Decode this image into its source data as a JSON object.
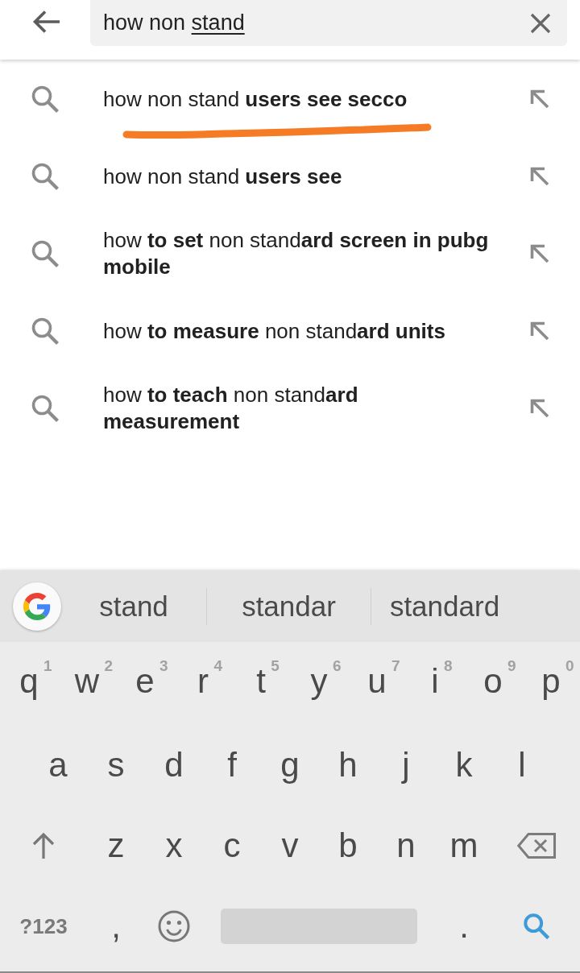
{
  "top_bar": {
    "search": {
      "typed": "how non",
      "composing": "stand"
    }
  },
  "suggestions": [
    {
      "text": "how non stand **users see secco**",
      "annotated": true
    },
    {
      "text": "how non stand **users see**",
      "annotated": false
    },
    {
      "text": "how **to set** non stand**ard screen in pubg mobile**",
      "annotated": false
    },
    {
      "text": "how **to measure** non stand**ard units**",
      "annotated": false
    },
    {
      "text": "how **to teach** non stand**ard measurement**",
      "annotated": false
    }
  ],
  "keyboard": {
    "candidates": [
      "stand",
      "standar",
      "standard"
    ],
    "letter_rows": [
      [
        {
          "kind": "letter",
          "label": "q",
          "hint": "1"
        },
        {
          "kind": "letter",
          "label": "w",
          "hint": "2"
        },
        {
          "kind": "letter",
          "label": "e",
          "hint": "3"
        },
        {
          "kind": "letter",
          "label": "r",
          "hint": "4"
        },
        {
          "kind": "letter",
          "label": "t",
          "hint": "5"
        },
        {
          "kind": "letter",
          "label": "y",
          "hint": "6"
        },
        {
          "kind": "letter",
          "label": "u",
          "hint": "7"
        },
        {
          "kind": "letter",
          "label": "i",
          "hint": "8"
        },
        {
          "kind": "letter",
          "label": "o",
          "hint": "9"
        },
        {
          "kind": "letter",
          "label": "p",
          "hint": "0"
        }
      ],
      [
        {
          "kind": "letter",
          "label": "a"
        },
        {
          "kind": "letter",
          "label": "s"
        },
        {
          "kind": "letter",
          "label": "d"
        },
        {
          "kind": "letter",
          "label": "f"
        },
        {
          "kind": "letter",
          "label": "g"
        },
        {
          "kind": "letter",
          "label": "h"
        },
        {
          "kind": "letter",
          "label": "j"
        },
        {
          "kind": "letter",
          "label": "k"
        },
        {
          "kind": "letter",
          "label": "l"
        }
      ],
      [
        {
          "kind": "shift"
        },
        {
          "kind": "letter",
          "label": "z"
        },
        {
          "kind": "letter",
          "label": "x"
        },
        {
          "kind": "letter",
          "label": "c"
        },
        {
          "kind": "letter",
          "label": "v"
        },
        {
          "kind": "letter",
          "label": "b"
        },
        {
          "kind": "letter",
          "label": "n"
        },
        {
          "kind": "letter",
          "label": "m"
        },
        {
          "kind": "backspace"
        }
      ]
    ],
    "bottom_row": [
      {
        "kind": "symbols",
        "label": "?123"
      },
      {
        "kind": "letter",
        "label": ","
      },
      {
        "kind": "emoji"
      },
      {
        "kind": "space"
      },
      {
        "kind": "letter",
        "label": "."
      },
      {
        "kind": "search"
      }
    ]
  }
}
